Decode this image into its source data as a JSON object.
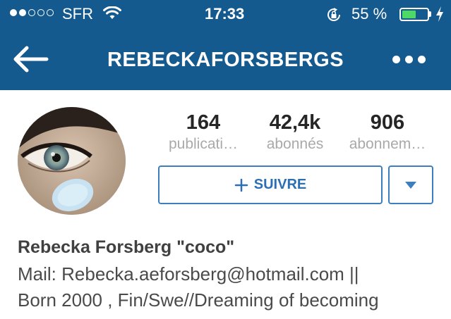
{
  "status_bar": {
    "carrier": "SFR",
    "time": "17:33",
    "battery_percent": "55 %",
    "battery_level": 0.55,
    "signal_bars_filled": 2,
    "signal_bars_total": 5
  },
  "nav": {
    "title": "REBECKAFORSBERGS",
    "back_icon": "back-arrow-icon",
    "more_icon": "more-dots-icon"
  },
  "profile": {
    "stats": [
      {
        "value": "164",
        "label": "publicati…"
      },
      {
        "value": "42,4k",
        "label": "abonnés"
      },
      {
        "value": "906",
        "label": "abonnem…"
      }
    ],
    "follow_label": "SUIVRE",
    "display_name": "Rebecka Forsberg \"coco\"",
    "bio_lines": [
      "Mail: Rebecka.aeforsberg@hotmail.com ||",
      "Born 2000 , Fin/Swe//Dreaming of becoming"
    ]
  },
  "colors": {
    "header_bg": "#155a8e",
    "accent": "#3d7ebf",
    "battery_green": "#4cd964"
  }
}
